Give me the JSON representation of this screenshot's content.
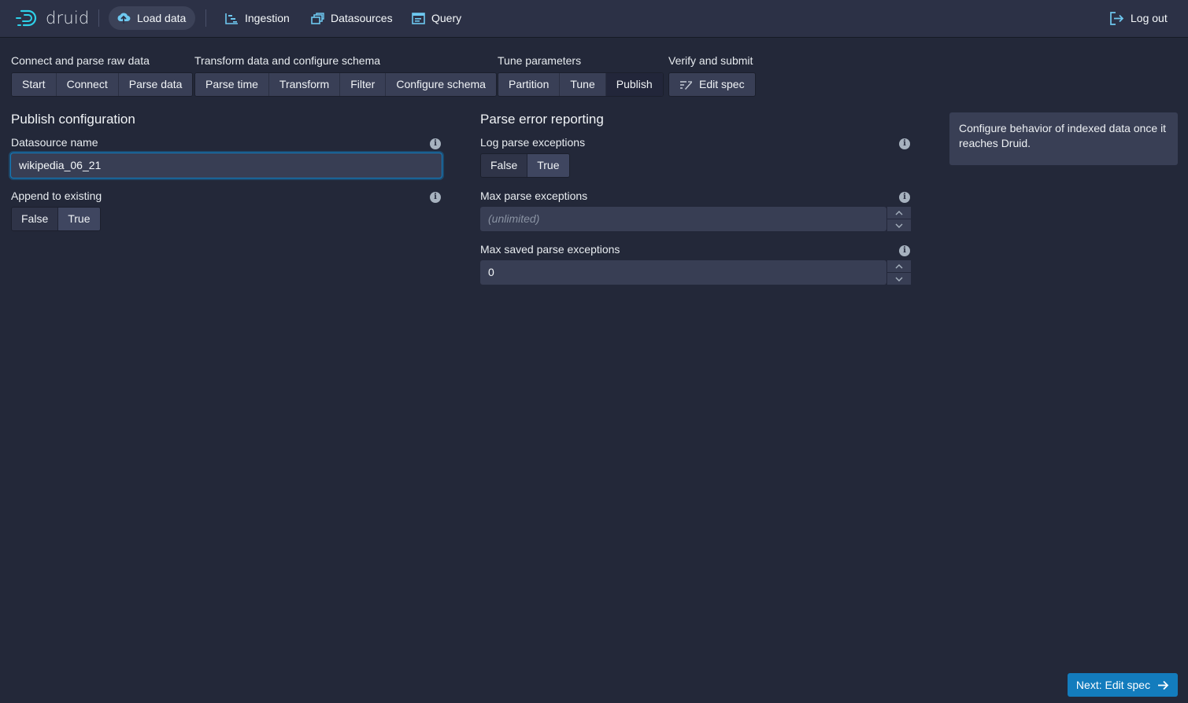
{
  "app": {
    "logo_text": "druid"
  },
  "nav": {
    "load_data": "Load data",
    "ingestion": "Ingestion",
    "datasources": "Datasources",
    "query": "Query",
    "logout": "Log out"
  },
  "steps": {
    "groups": [
      {
        "title": "Connect and parse raw data",
        "items": [
          "Start",
          "Connect",
          "Parse data"
        ]
      },
      {
        "title": "Transform data and configure schema",
        "items": [
          "Parse time",
          "Transform",
          "Filter",
          "Configure schema"
        ]
      },
      {
        "title": "Tune parameters",
        "items": [
          "Partition",
          "Tune",
          "Publish"
        ]
      },
      {
        "title": "Verify and submit",
        "items": [
          "Edit spec"
        ]
      }
    ],
    "active": "Publish"
  },
  "publish": {
    "title": "Publish configuration",
    "datasource_label": "Datasource name",
    "datasource_value": "wikipedia_06_21",
    "append_label": "Append to existing",
    "append_false": "False",
    "append_true": "True",
    "append_selected": "True"
  },
  "parse_errors": {
    "title": "Parse error reporting",
    "log_label": "Log parse exceptions",
    "log_false": "False",
    "log_true": "True",
    "log_selected": "True",
    "max_label": "Max parse exceptions",
    "max_placeholder": "(unlimited)",
    "max_saved_label": "Max saved parse exceptions",
    "max_saved_value": "0"
  },
  "callout": {
    "text": "Configure behavior of indexed data once it reaches Druid."
  },
  "footer": {
    "next_label": "Next: Edit spec"
  },
  "colors": {
    "accent": "#137cbd",
    "logo": "#2ed0e8",
    "background": "#232839"
  }
}
